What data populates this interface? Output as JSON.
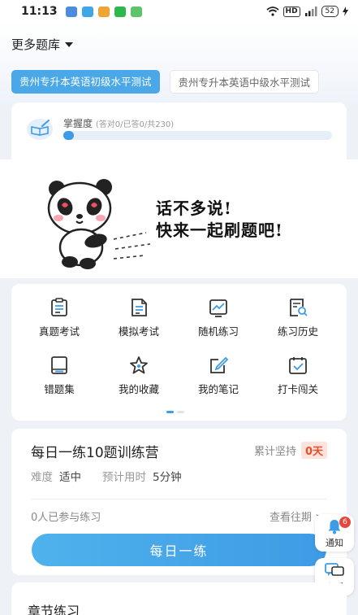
{
  "status_bar": {
    "time": "11:13",
    "hd_label": "HD",
    "battery": "52"
  },
  "header": {
    "more_library": "更多题库"
  },
  "tabs": [
    {
      "label": "贵州专升本英语初级水平测试",
      "active": true
    },
    {
      "label": "贵州专升本英语中级水平测试",
      "active": false
    }
  ],
  "mastery": {
    "label": "掌握度",
    "detail": "(答对0/已答0/共230)",
    "progress_fraction": 0.04
  },
  "banner": {
    "line1": "话不多说!",
    "line2": "快来一起刷题吧!"
  },
  "grid": [
    {
      "label": "真题考试",
      "icon": "exam-paper-icon"
    },
    {
      "label": "模拟考试",
      "icon": "mock-exam-icon"
    },
    {
      "label": "随机练习",
      "icon": "random-chart-icon"
    },
    {
      "label": "练习历史",
      "icon": "history-search-icon"
    },
    {
      "label": "错题集",
      "icon": "mistake-book-icon"
    },
    {
      "label": "我的收藏",
      "icon": "star-icon"
    },
    {
      "label": "我的笔记",
      "icon": "note-pen-icon"
    },
    {
      "label": "打卡闯关",
      "icon": "calendar-check-icon"
    }
  ],
  "daily": {
    "title": "每日一练10题训练营",
    "streak_label": "累计坚持",
    "streak_value": "0天",
    "difficulty_label": "难度",
    "difficulty_value": "适中",
    "time_label": "预计用时",
    "time_value": "5分钟",
    "participants": "0人已参与练习",
    "past_link": "查看往期 >",
    "button": "每日一练"
  },
  "float": {
    "notify_label": "通知",
    "notify_count": "6",
    "service_label": "客服"
  },
  "chapter": {
    "title": "章节练习"
  },
  "colors": {
    "accent": "#3e9be5",
    "streak": "#e6502a",
    "badge": "#e8453c"
  }
}
